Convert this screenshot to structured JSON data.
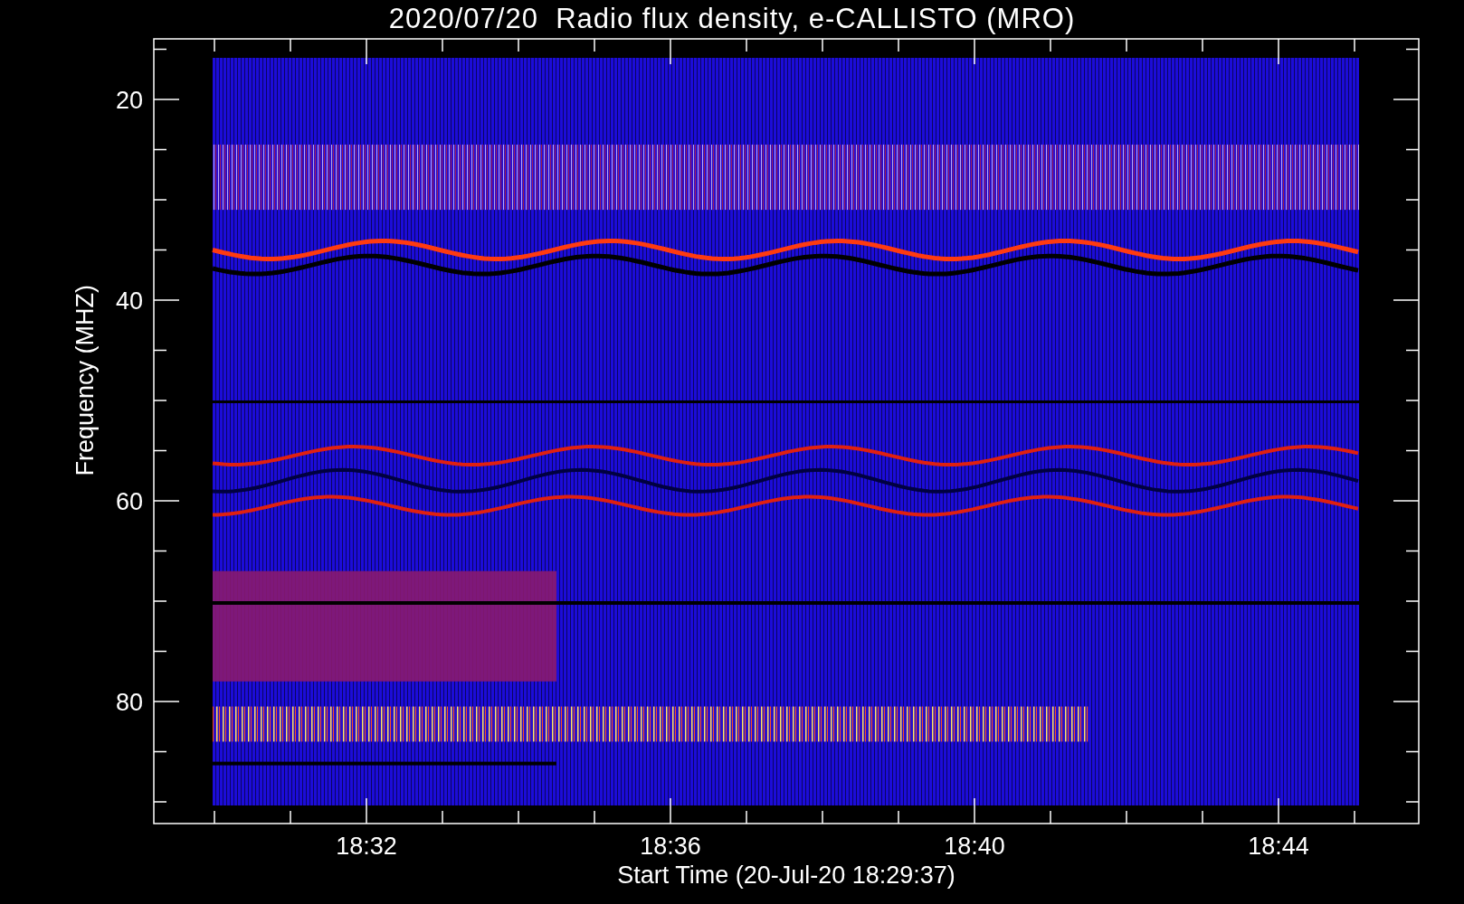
{
  "title": "2020/07/20  Radio flux density, e-CALLISTO (MRO)",
  "y_axis": {
    "label": "Frequency (MHZ)",
    "tick_labels": [
      "20",
      "40",
      "60",
      "80"
    ]
  },
  "x_axis": {
    "label": "Start Time (20-Jul-20 18:29:37)",
    "tick_labels": [
      "18:32",
      "18:36",
      "18:40",
      "18:44"
    ]
  }
}
